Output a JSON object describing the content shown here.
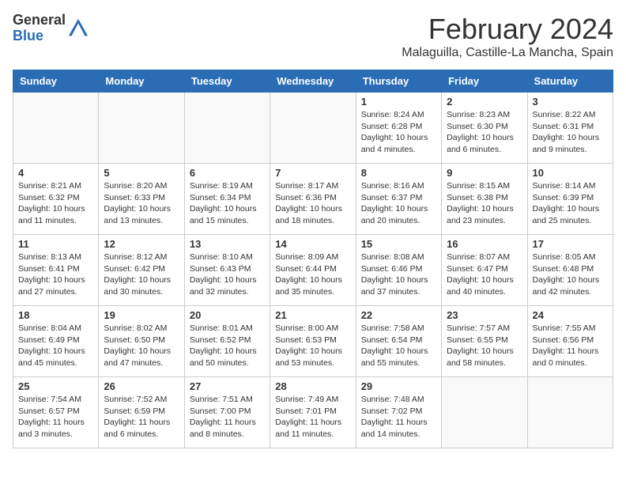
{
  "logo": {
    "general": "General",
    "blue": "Blue"
  },
  "header": {
    "month": "February 2024",
    "location": "Malaguilla, Castille-La Mancha, Spain"
  },
  "days_of_week": [
    "Sunday",
    "Monday",
    "Tuesday",
    "Wednesday",
    "Thursday",
    "Friday",
    "Saturday"
  ],
  "weeks": [
    [
      {
        "day": "",
        "info": ""
      },
      {
        "day": "",
        "info": ""
      },
      {
        "day": "",
        "info": ""
      },
      {
        "day": "",
        "info": ""
      },
      {
        "day": "1",
        "info": "Sunrise: 8:24 AM\nSunset: 6:28 PM\nDaylight: 10 hours and 4 minutes."
      },
      {
        "day": "2",
        "info": "Sunrise: 8:23 AM\nSunset: 6:30 PM\nDaylight: 10 hours and 6 minutes."
      },
      {
        "day": "3",
        "info": "Sunrise: 8:22 AM\nSunset: 6:31 PM\nDaylight: 10 hours and 9 minutes."
      }
    ],
    [
      {
        "day": "4",
        "info": "Sunrise: 8:21 AM\nSunset: 6:32 PM\nDaylight: 10 hours and 11 minutes."
      },
      {
        "day": "5",
        "info": "Sunrise: 8:20 AM\nSunset: 6:33 PM\nDaylight: 10 hours and 13 minutes."
      },
      {
        "day": "6",
        "info": "Sunrise: 8:19 AM\nSunset: 6:34 PM\nDaylight: 10 hours and 15 minutes."
      },
      {
        "day": "7",
        "info": "Sunrise: 8:17 AM\nSunset: 6:36 PM\nDaylight: 10 hours and 18 minutes."
      },
      {
        "day": "8",
        "info": "Sunrise: 8:16 AM\nSunset: 6:37 PM\nDaylight: 10 hours and 20 minutes."
      },
      {
        "day": "9",
        "info": "Sunrise: 8:15 AM\nSunset: 6:38 PM\nDaylight: 10 hours and 23 minutes."
      },
      {
        "day": "10",
        "info": "Sunrise: 8:14 AM\nSunset: 6:39 PM\nDaylight: 10 hours and 25 minutes."
      }
    ],
    [
      {
        "day": "11",
        "info": "Sunrise: 8:13 AM\nSunset: 6:41 PM\nDaylight: 10 hours and 27 minutes."
      },
      {
        "day": "12",
        "info": "Sunrise: 8:12 AM\nSunset: 6:42 PM\nDaylight: 10 hours and 30 minutes."
      },
      {
        "day": "13",
        "info": "Sunrise: 8:10 AM\nSunset: 6:43 PM\nDaylight: 10 hours and 32 minutes."
      },
      {
        "day": "14",
        "info": "Sunrise: 8:09 AM\nSunset: 6:44 PM\nDaylight: 10 hours and 35 minutes."
      },
      {
        "day": "15",
        "info": "Sunrise: 8:08 AM\nSunset: 6:46 PM\nDaylight: 10 hours and 37 minutes."
      },
      {
        "day": "16",
        "info": "Sunrise: 8:07 AM\nSunset: 6:47 PM\nDaylight: 10 hours and 40 minutes."
      },
      {
        "day": "17",
        "info": "Sunrise: 8:05 AM\nSunset: 6:48 PM\nDaylight: 10 hours and 42 minutes."
      }
    ],
    [
      {
        "day": "18",
        "info": "Sunrise: 8:04 AM\nSunset: 6:49 PM\nDaylight: 10 hours and 45 minutes."
      },
      {
        "day": "19",
        "info": "Sunrise: 8:02 AM\nSunset: 6:50 PM\nDaylight: 10 hours and 47 minutes."
      },
      {
        "day": "20",
        "info": "Sunrise: 8:01 AM\nSunset: 6:52 PM\nDaylight: 10 hours and 50 minutes."
      },
      {
        "day": "21",
        "info": "Sunrise: 8:00 AM\nSunset: 6:53 PM\nDaylight: 10 hours and 53 minutes."
      },
      {
        "day": "22",
        "info": "Sunrise: 7:58 AM\nSunset: 6:54 PM\nDaylight: 10 hours and 55 minutes."
      },
      {
        "day": "23",
        "info": "Sunrise: 7:57 AM\nSunset: 6:55 PM\nDaylight: 10 hours and 58 minutes."
      },
      {
        "day": "24",
        "info": "Sunrise: 7:55 AM\nSunset: 6:56 PM\nDaylight: 11 hours and 0 minutes."
      }
    ],
    [
      {
        "day": "25",
        "info": "Sunrise: 7:54 AM\nSunset: 6:57 PM\nDaylight: 11 hours and 3 minutes."
      },
      {
        "day": "26",
        "info": "Sunrise: 7:52 AM\nSunset: 6:59 PM\nDaylight: 11 hours and 6 minutes."
      },
      {
        "day": "27",
        "info": "Sunrise: 7:51 AM\nSunset: 7:00 PM\nDaylight: 11 hours and 8 minutes."
      },
      {
        "day": "28",
        "info": "Sunrise: 7:49 AM\nSunset: 7:01 PM\nDaylight: 11 hours and 11 minutes."
      },
      {
        "day": "29",
        "info": "Sunrise: 7:48 AM\nSunset: 7:02 PM\nDaylight: 11 hours and 14 minutes."
      },
      {
        "day": "",
        "info": ""
      },
      {
        "day": "",
        "info": ""
      }
    ]
  ]
}
